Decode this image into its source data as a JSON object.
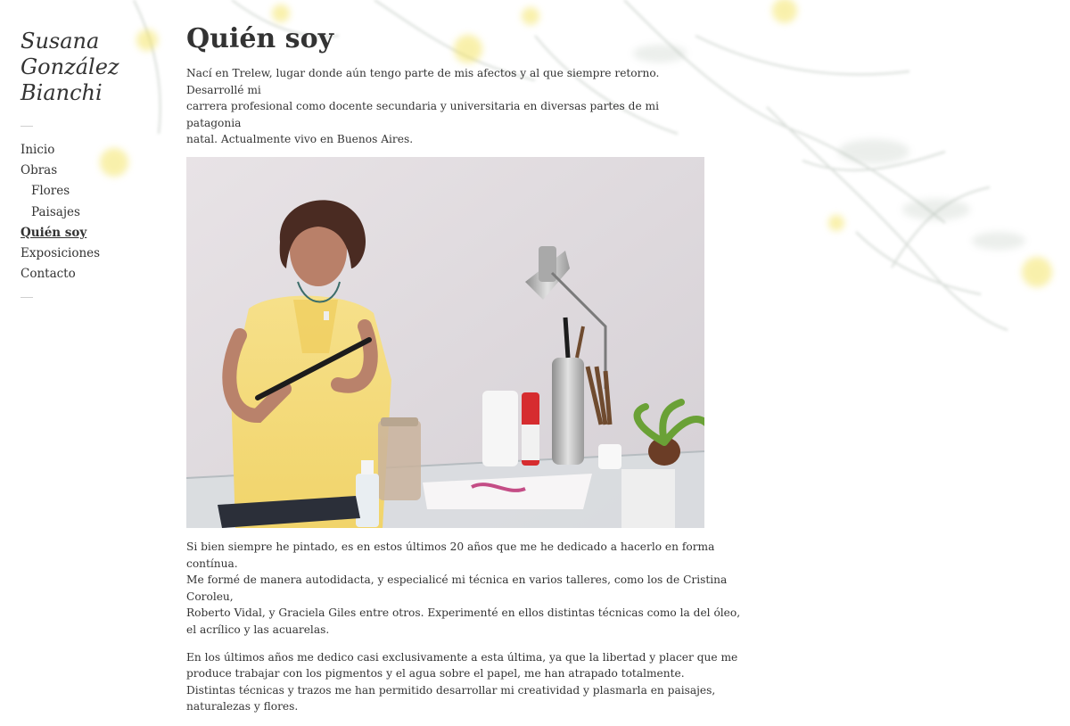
{
  "site": {
    "title_lines": [
      "Susana",
      "González",
      "Bianchi"
    ]
  },
  "nav": {
    "items": [
      {
        "label": "Inicio",
        "sub": false,
        "active": false
      },
      {
        "label": "Obras",
        "sub": false,
        "active": false
      },
      {
        "label": "Flores",
        "sub": true,
        "active": false
      },
      {
        "label": "Paisajes",
        "sub": true,
        "active": false
      },
      {
        "label": "Quién soy",
        "sub": false,
        "active": true
      },
      {
        "label": "Exposiciones",
        "sub": false,
        "active": false
      },
      {
        "label": "Contacto",
        "sub": false,
        "active": false
      }
    ]
  },
  "page": {
    "title": "Quién soy",
    "intro": [
      "Nací en Trelew, lugar donde aún tengo parte de mis afectos y al que siempre retorno. Desarrollé mi",
      "carrera profesional como docente secundaria y universitaria en diversas partes de mi patagonia",
      "natal. Actualmente vivo en Buenos Aires."
    ],
    "paragraph2": [
      "Si bien siempre he pintado, es en estos últimos 20 años que me he dedicado a hacerlo en forma contínua.",
      "Me formé de manera autodidacta, y especialicé mi técnica en varios talleres, como los de Cristina Coroleu,",
      "Roberto Vidal, y Graciela Giles entre otros. Experimenté en ellos distintas técnicas como la del óleo,",
      "el acrílico y las acuarelas."
    ],
    "paragraph3": [
      "En los últimos años me dedico casi exclusivamente a esta última, ya que la libertad y placer que me",
      "produce trabajar con los pigmentos y el agua sobre el papel, me han atrapado totalmente.",
      "Distintas técnicas y trazos me han permitido desarrollar mi creatividad y plasmarla en paisajes,",
      "naturalezas y flores."
    ]
  },
  "colors": {
    "text": "#333333",
    "background": "#ffffff",
    "watercolor_yellow": "#f3e25a",
    "watercolor_stem": "#9aa89a"
  }
}
